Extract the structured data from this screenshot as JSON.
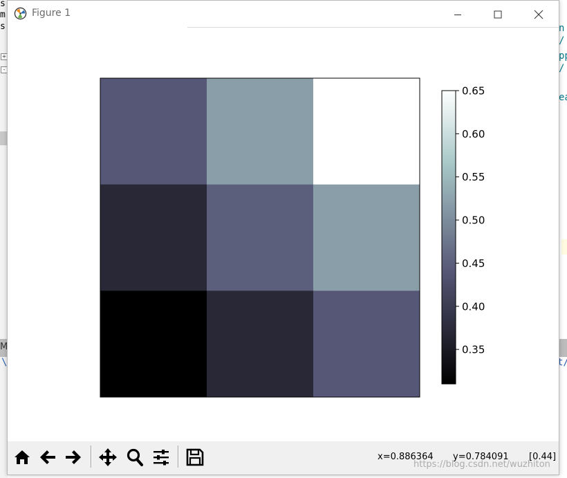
{
  "window": {
    "title": "Figure 1",
    "controls": {
      "minimize": "minimize",
      "maximize": "maximize",
      "close": "close"
    }
  },
  "background": {
    "left_lines": [
      "s",
      "m",
      "sr"
    ],
    "right_lines": [
      "n",
      "/",
      "pp",
      "/",
      "ea"
    ],
    "bottom_left_letter": "M",
    "bottom_left_line": "\\",
    "bottom_right_line": "t/"
  },
  "chart_data": {
    "type": "heatmap",
    "rows": 3,
    "cols": 3,
    "values": [
      [
        0.44,
        0.52,
        0.65
      ],
      [
        0.37,
        0.45,
        0.52
      ],
      [
        0.31,
        0.37,
        0.44
      ]
    ],
    "colormap": "bone",
    "vmin": 0.31,
    "vmax": 0.65,
    "colorbar_ticks": [
      "0.35",
      "0.40",
      "0.45",
      "0.50",
      "0.55",
      "0.60",
      "0.65"
    ],
    "colorbar_tick_values": [
      0.35,
      0.4,
      0.45,
      0.5,
      0.55,
      0.6,
      0.65
    ],
    "axes_visible": false
  },
  "toolbar": {
    "buttons": [
      {
        "name": "home-button",
        "icon": "home-icon"
      },
      {
        "name": "back-button",
        "icon": "arrow-left-icon"
      },
      {
        "name": "forward-button",
        "icon": "arrow-right-icon"
      },
      {
        "name": "pan-button",
        "icon": "move-icon"
      },
      {
        "name": "zoom-button",
        "icon": "magnifier-icon"
      },
      {
        "name": "configure-subplots-button",
        "icon": "sliders-icon"
      },
      {
        "name": "save-button",
        "icon": "floppy-icon"
      }
    ],
    "coords": {
      "x": "x=0.886364",
      "y": "y=0.784091",
      "value": "[0.44]"
    }
  },
  "watermark": "https://blog.csdn.net/wuzhiton"
}
